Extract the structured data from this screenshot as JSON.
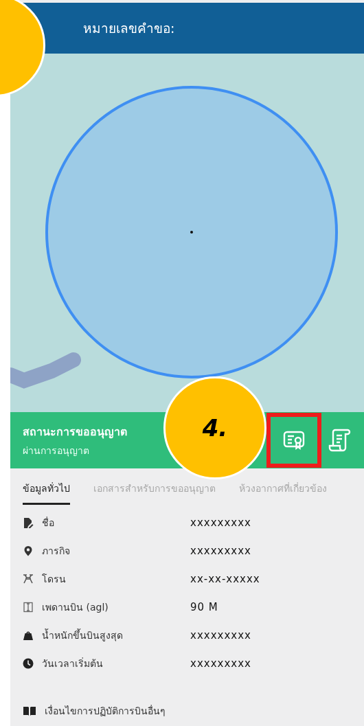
{
  "header": {
    "title": "หมายเลขคำขอ:"
  },
  "status": {
    "title": "สถานะการขออนุญาต",
    "value": "ผ่านการอนุญาต"
  },
  "callouts": [
    {
      "kind": "blank"
    },
    {
      "kind": "numbered",
      "label": "4."
    }
  ],
  "tabs": [
    {
      "label": "ข้อมูลทั่วไป",
      "selected": true
    },
    {
      "label": "เอกสารสำหรับการขออนุญาต",
      "selected": false
    },
    {
      "label": "ห้วงอากาศที่เกี่ยวข้อง",
      "selected": false
    }
  ],
  "details": [
    {
      "kind": "name",
      "label": "ชื่อ",
      "value": "xxxxxxxxx"
    },
    {
      "kind": "mission",
      "label": "ภารกิจ",
      "value": "xxxxxxxxx"
    },
    {
      "kind": "drone",
      "label": "โดรน",
      "value": "xx-xx-xxxxx"
    },
    {
      "kind": "ceiling",
      "label": "เพดานบิน (agl)",
      "value": "90 M"
    },
    {
      "kind": "weight",
      "label": "น้ำหนักขึ้นบินสูงสุด",
      "value": "xxxxxxxxx"
    },
    {
      "kind": "time",
      "label": "วันเวลาเริ่มต้น",
      "value": "xxxxxxxxx"
    }
  ],
  "conditions": {
    "label": "เงื่อนไขการปฏิบัติการบินอื่นๆ"
  }
}
